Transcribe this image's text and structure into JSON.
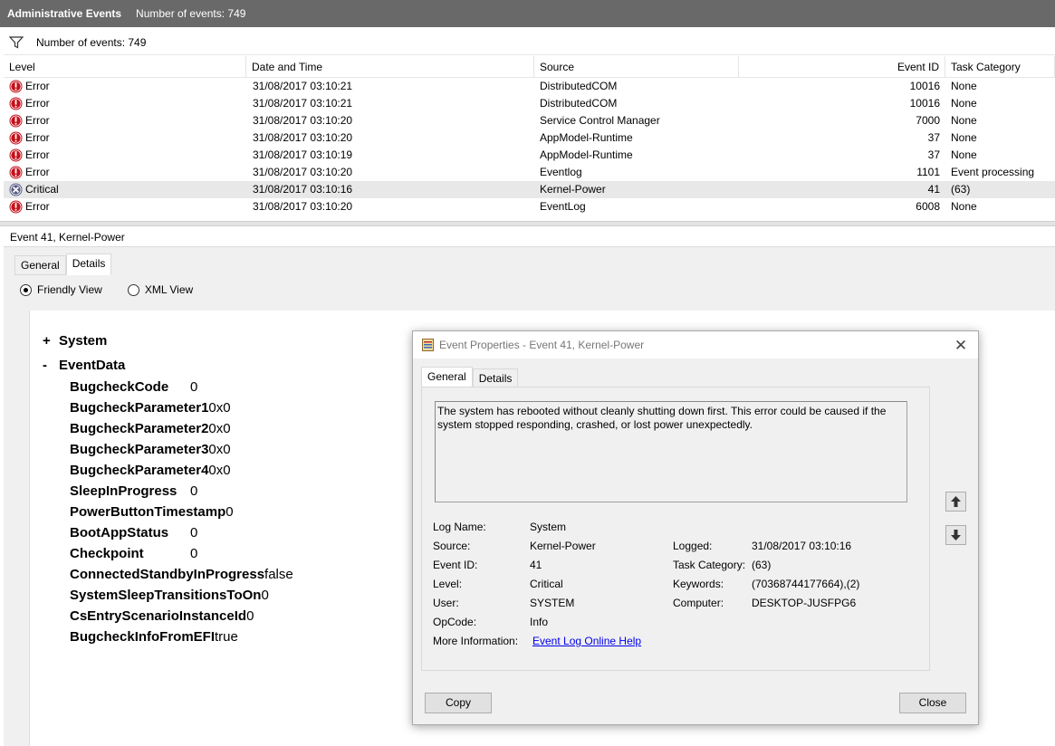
{
  "titlebar": {
    "title": "Administrative Events",
    "count": "Number of events: 749"
  },
  "filterbar": {
    "icon": "funnel-icon",
    "count": "Number of events: 749"
  },
  "table": {
    "headers": {
      "level": "Level",
      "datetime": "Date and Time",
      "source": "Source",
      "eventid": "Event ID",
      "category": "Task Category"
    },
    "rows": [
      {
        "icon": "error-icon",
        "level": "Error",
        "datetime": "31/08/2017 03:10:21",
        "source": "DistributedCOM",
        "eventid": "10016",
        "category": "None"
      },
      {
        "icon": "error-icon",
        "level": "Error",
        "datetime": "31/08/2017 03:10:21",
        "source": "DistributedCOM",
        "eventid": "10016",
        "category": "None"
      },
      {
        "icon": "error-icon",
        "level": "Error",
        "datetime": "31/08/2017 03:10:20",
        "source": "Service Control Manager",
        "eventid": "7000",
        "category": "None"
      },
      {
        "icon": "error-icon",
        "level": "Error",
        "datetime": "31/08/2017 03:10:20",
        "source": "AppModel-Runtime",
        "eventid": "37",
        "category": "None"
      },
      {
        "icon": "error-icon",
        "level": "Error",
        "datetime": "31/08/2017 03:10:19",
        "source": "AppModel-Runtime",
        "eventid": "37",
        "category": "None"
      },
      {
        "icon": "error-icon",
        "level": "Error",
        "datetime": "31/08/2017 03:10:20",
        "source": "Eventlog",
        "eventid": "1101",
        "category": "Event processing"
      },
      {
        "icon": "critical-icon",
        "level": "Critical",
        "datetime": "31/08/2017 03:10:16",
        "source": "Kernel-Power",
        "eventid": "41",
        "category": "(63)"
      },
      {
        "icon": "error-icon",
        "level": "Error",
        "datetime": "31/08/2017 03:10:20",
        "source": "EventLog",
        "eventid": "6008",
        "category": "None"
      }
    ]
  },
  "event_header": "Event 41, Kernel-Power",
  "bottom_tabs": {
    "general": "General",
    "details": "Details"
  },
  "view_options": {
    "friendly": "Friendly View",
    "xml": "XML View"
  },
  "tree": {
    "system": {
      "sign": "+",
      "label": "System"
    },
    "eventdata": {
      "sign": "-",
      "label": "EventData"
    },
    "fields": [
      {
        "name": "BugcheckCode",
        "value": "0"
      },
      {
        "name": "BugcheckParameter1",
        "value": "0x0"
      },
      {
        "name": "BugcheckParameter2",
        "value": "0x0"
      },
      {
        "name": "BugcheckParameter3",
        "value": "0x0"
      },
      {
        "name": "BugcheckParameter4",
        "value": "0x0"
      },
      {
        "name": "SleepInProgress",
        "value": "0"
      },
      {
        "name": "PowerButtonTimestamp",
        "value": "0"
      },
      {
        "name": "BootAppStatus",
        "value": "0"
      },
      {
        "name": "Checkpoint",
        "value": "0"
      },
      {
        "name": "ConnectedStandbyInProgress",
        "value": "false"
      },
      {
        "name": "SystemSleepTransitionsToOn",
        "value": "0"
      },
      {
        "name": "CsEntryScenarioInstanceId",
        "value": "0"
      },
      {
        "name": "BugcheckInfoFromEFI",
        "value": "true"
      }
    ]
  },
  "dialog": {
    "title": "Event Properties - Event 41, Kernel-Power",
    "close_glyph": "✕",
    "tabs": {
      "general": "General",
      "details": "Details"
    },
    "message": "The system has rebooted without cleanly shutting down first. This error could be caused if the system stopped responding, crashed, or lost power unexpectedly.",
    "labels": {
      "log_name": "Log Name:",
      "source": "Source:",
      "event_id": "Event ID:",
      "level": "Level:",
      "user": "User:",
      "opcode": "OpCode:",
      "more_info": "More Information:",
      "logged": "Logged:",
      "task_category": "Task Category:",
      "keywords": "Keywords:",
      "computer": "Computer:"
    },
    "values": {
      "log_name": "System",
      "source": "Kernel-Power",
      "event_id": "41",
      "level": "Critical",
      "user": "SYSTEM",
      "opcode": "Info",
      "more_info": "Event Log Online Help",
      "logged": "31/08/2017 03:10:16",
      "task_category": "(63)",
      "keywords": "(70368744177664),(2)",
      "computer": "DESKTOP-JUSFPG6"
    },
    "buttons": {
      "copy": "Copy",
      "close": "Close",
      "up": "arrow-up-icon",
      "down": "arrow-down-icon"
    }
  }
}
